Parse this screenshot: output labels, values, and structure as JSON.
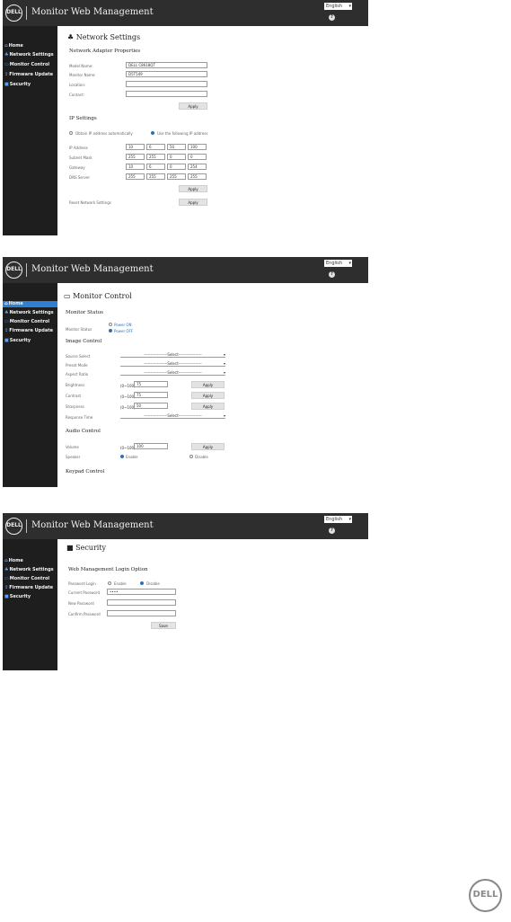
{
  "app": {
    "logo_text": "DELL",
    "title": "Monitor Web Management",
    "language": "English",
    "help_icon": "question-icon"
  },
  "sidebar": [
    {
      "label": "Home",
      "icon": "home-icon"
    },
    {
      "label": "Network Settings",
      "icon": "network-icon"
    },
    {
      "label": "Monitor Control",
      "icon": "monitor-icon"
    },
    {
      "label": "Firmware Update",
      "icon": "upload-icon"
    },
    {
      "label": "Security",
      "icon": "lock-icon"
    }
  ],
  "network": {
    "title": "Network Settings",
    "adapter_heading": "Network Adapter Properties",
    "model_name_label": "Model Name:",
    "model_name": "DELL C8618QT",
    "monitor_name_label": "Monitor Name:",
    "monitor_name": "D5T549",
    "location_label": "Location:",
    "contact_label": "Contact:",
    "apply": "Apply",
    "ip_heading": "IP Settings",
    "dhcp_option": "Obtain IP address automatically",
    "static_option": "Use the following IP address",
    "ip_label": "IP Address",
    "ip": [
      "10",
      "6",
      "50",
      "100"
    ],
    "mask_label": "Subnet Mask",
    "mask": [
      "255",
      "255",
      "0",
      "0"
    ],
    "gateway_label": "Gateway",
    "gateway": [
      "10",
      "6",
      "0",
      "254"
    ],
    "dns_label": "DNS Server",
    "dns": [
      "255",
      "255",
      "255",
      "255"
    ],
    "reset_label": "Reset Network Settings"
  },
  "monitor": {
    "title": "Monitor Control",
    "status_heading": "Monitor Status",
    "status_label": "Monitor Status",
    "power_on": "Power ON",
    "power_off": "Power OFF",
    "image_heading": "Image Control",
    "source_label": "Source Select",
    "preset_label": "Preset Mode",
    "aspect_label": "Aspect Ratio",
    "select_placeholder": "------------------Select------------------",
    "brightness_label": "Brightness",
    "brightness": "75",
    "contrast_label": "Contrast",
    "contrast": "75",
    "sharpness_label": "Sharpness",
    "sharpness": "50",
    "range_hint": "(0~100)",
    "response_label": "Response Time",
    "apply": "Apply",
    "audio_heading": "Audio Control",
    "volume_label": "Volume",
    "volume": "100",
    "speaker_label": "Speaker",
    "enable": "Enable",
    "disable": "Disable",
    "keypad_heading": "Keypad Control"
  },
  "security": {
    "title": "Security",
    "login_heading": "Web Management Login Option",
    "password_login_label": "Password Login",
    "enable": "Enable",
    "disable": "Disable",
    "current_label": "Current Password",
    "current_value": "••••",
    "new_label": "New Password",
    "confirm_label": "Confirm Password",
    "save": "Save"
  },
  "footer": {
    "logo_text": "DELL"
  }
}
